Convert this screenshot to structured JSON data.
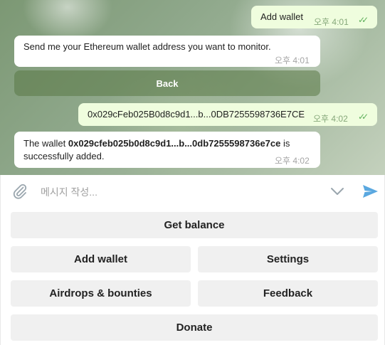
{
  "messages": [
    {
      "type": "out",
      "text": "Add wallet",
      "time": "오후 4:01",
      "status": "read"
    },
    {
      "type": "in",
      "text": "Send me your Ethereum wallet address you want to monitor.",
      "time": "오후 4:01"
    },
    {
      "type": "out",
      "text": "0x029cFeb025B0d8c9d1...b...0DB7255598736E7CE",
      "time": "오후 4:02",
      "status": "read"
    },
    {
      "type": "in",
      "prefix": "The wallet ",
      "address": "0x029cfeb025b0d8c9d1...b...0db7255598736e7ce",
      "suffix_line1": " is",
      "suffix_line2": "successfully added.",
      "time": "오후 4:02"
    }
  ],
  "inline_button": {
    "label": "Back"
  },
  "composer": {
    "placeholder": "메시지 작성..."
  },
  "keyboard": {
    "rows": [
      [
        "Get balance"
      ],
      [
        "Add wallet",
        "Settings"
      ],
      [
        "Airdrops & bounties",
        "Feedback"
      ],
      [
        "Donate"
      ]
    ]
  },
  "colors": {
    "outgoing": "#effdde",
    "incoming": "#ffffff",
    "accent": "#5aa8e0",
    "checks": "#5fb05c"
  },
  "icons": [
    "attach-icon",
    "chevron-down-icon",
    "send-icon",
    "double-check-icon"
  ]
}
